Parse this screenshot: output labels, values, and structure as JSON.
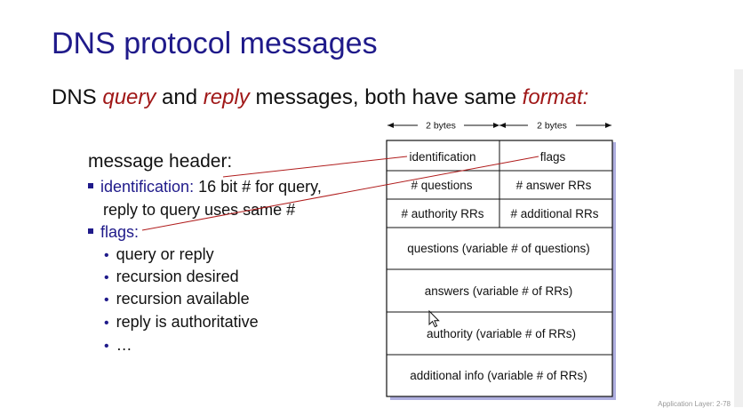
{
  "slide": {
    "title": "DNS protocol messages",
    "subtitle": {
      "part1": "DNS ",
      "query": "query",
      "part2": " and ",
      "reply": "reply",
      "part3": " messages, both have same  ",
      "format": "format:"
    },
    "footer": "Application Layer: 2-78"
  },
  "notes": {
    "header_label": "message header:",
    "identification_term": "identification:",
    "identification_desc_1": " 16 bit # for query,",
    "identification_desc_2": "reply to query uses same #",
    "flags_term": "flags:",
    "flag_items": [
      "query or reply",
      "recursion desired",
      "recursion available",
      "reply is authoritative",
      "…"
    ]
  },
  "diagram": {
    "byte_labels": [
      "2 bytes",
      "2 bytes"
    ],
    "rows": [
      [
        "identification",
        "flags"
      ],
      [
        "# questions",
        "# answer RRs"
      ],
      [
        "# authority RRs",
        "# additional RRs"
      ],
      [
        "questions (variable # of questions)"
      ],
      [
        "answers (variable # of RRs)"
      ],
      [
        "authority (variable # of RRs)"
      ],
      [
        "additional info (variable # of RRs)"
      ]
    ]
  },
  "colors": {
    "title": "#1f1a8a",
    "emphasis": "#a01818",
    "connector": "#b01c1c",
    "box_shadow": "#9b9bd8"
  }
}
